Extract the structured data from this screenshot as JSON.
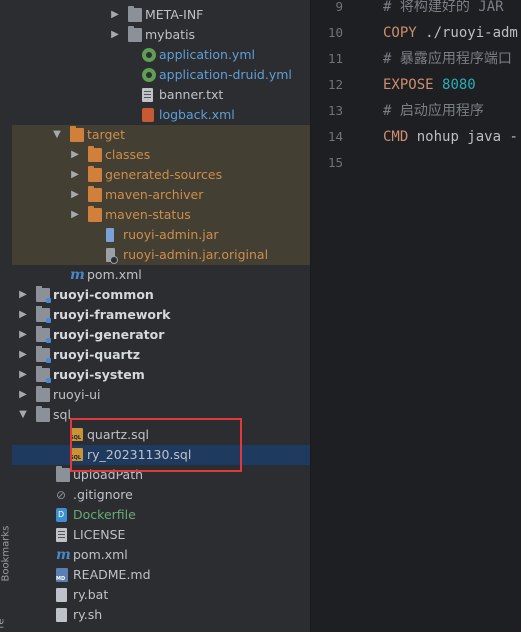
{
  "sidestrip": {
    "label": "Bookmarks",
    "label2": "re"
  },
  "tree": {
    "rows": [
      {
        "label": "META-INF",
        "arrow": "▶",
        "icon": "folder-icon",
        "style": "def"
      },
      {
        "label": "mybatis",
        "arrow": "▶",
        "icon": "folder-icon",
        "style": "def"
      },
      {
        "label": "application.yml",
        "icon": "spring-config-icon",
        "style": "blue"
      },
      {
        "label": "application-druid.yml",
        "icon": "spring-config-icon",
        "style": "blue"
      },
      {
        "label": "banner.txt",
        "icon": "text-file-icon",
        "style": "def"
      },
      {
        "label": "logback.xml",
        "icon": "xml-file-icon",
        "style": "blue"
      },
      {
        "label": "target",
        "arrow": "▼",
        "icon": "folder-icon",
        "style": "orange"
      },
      {
        "label": "classes",
        "arrow": "▶",
        "icon": "folder-icon",
        "style": "orange"
      },
      {
        "label": "generated-sources",
        "arrow": "▶",
        "icon": "folder-icon",
        "style": "orange"
      },
      {
        "label": "maven-archiver",
        "arrow": "▶",
        "icon": "folder-icon",
        "style": "orange"
      },
      {
        "label": "maven-status",
        "arrow": "▶",
        "icon": "folder-icon",
        "style": "orange"
      },
      {
        "label": "ruoyi-admin.jar",
        "icon": "jar-icon",
        "style": "orange"
      },
      {
        "label": "ruoyi-admin.jar.original",
        "icon": "jar-original-icon",
        "style": "orange"
      },
      {
        "label": "pom.xml",
        "icon": "maven-icon",
        "style": "def"
      },
      {
        "label": "ruoyi-common",
        "arrow": "▶",
        "icon": "module-folder-icon",
        "style": "bold"
      },
      {
        "label": "ruoyi-framework",
        "arrow": "▶",
        "icon": "module-folder-icon",
        "style": "bold"
      },
      {
        "label": "ruoyi-generator",
        "arrow": "▶",
        "icon": "module-folder-icon",
        "style": "bold"
      },
      {
        "label": "ruoyi-quartz",
        "arrow": "▶",
        "icon": "module-folder-icon",
        "style": "bold"
      },
      {
        "label": "ruoyi-system",
        "arrow": "▶",
        "icon": "module-folder-icon",
        "style": "bold"
      },
      {
        "label": "ruoyi-ui",
        "arrow": "▶",
        "icon": "folder-icon",
        "style": "def"
      },
      {
        "label": "sql",
        "arrow": "▼",
        "icon": "folder-icon",
        "style": "def"
      },
      {
        "label": "quartz.sql",
        "icon": "sql-file-icon",
        "style": "def"
      },
      {
        "label": "ry_20231130.sql",
        "icon": "sql-file-icon",
        "style": "def"
      },
      {
        "label": "uploadPath",
        "icon": "folder-icon",
        "style": "def"
      },
      {
        "label": ".gitignore",
        "icon": "gitignore-icon",
        "style": "def"
      },
      {
        "label": "Dockerfile",
        "icon": "docker-icon",
        "style": "green"
      },
      {
        "label": "LICENSE",
        "icon": "text-file-icon",
        "style": "def"
      },
      {
        "label": "pom.xml",
        "icon": "maven-icon",
        "style": "def"
      },
      {
        "label": "README.md",
        "icon": "markdown-icon",
        "style": "def"
      },
      {
        "label": "ry.bat",
        "icon": "bat-file-icon",
        "style": "def"
      },
      {
        "label": "ry.sh",
        "icon": "shell-file-icon",
        "style": "def"
      }
    ]
  },
  "editor": {
    "line_numbers": [
      "9",
      "10",
      "11",
      "12",
      "13",
      "14",
      "15"
    ],
    "lines": [
      [
        {
          "t": "# 将构建好的 JAR ",
          "k": "comment"
        }
      ],
      [
        {
          "t": "COPY",
          "k": "kw"
        },
        {
          "t": " ./ruoyi-adm",
          "k": "plain"
        }
      ],
      [
        {
          "t": "# 暴露应用程序端口",
          "k": "comment"
        }
      ],
      [
        {
          "t": "EXPOSE",
          "k": "kw"
        },
        {
          "t": " ",
          "k": "plain"
        },
        {
          "t": "8080",
          "k": "num"
        }
      ],
      [
        {
          "t": "# 启动应用程序",
          "k": "comment"
        }
      ],
      [
        {
          "t": "CMD",
          "k": "kw"
        },
        {
          "t": " nohup java -",
          "k": "plain"
        }
      ],
      []
    ]
  },
  "colors": {
    "panel_bg": "#2b2d30",
    "editor_bg": "#1e1f22",
    "excluded_bg": "#433f32",
    "selection_bg": "#1e3a5f",
    "highlight_border": "#e0383b",
    "orange_text": "#cf8d4c",
    "green_text": "#6aab73",
    "blue_text": "#5f9ed6"
  }
}
